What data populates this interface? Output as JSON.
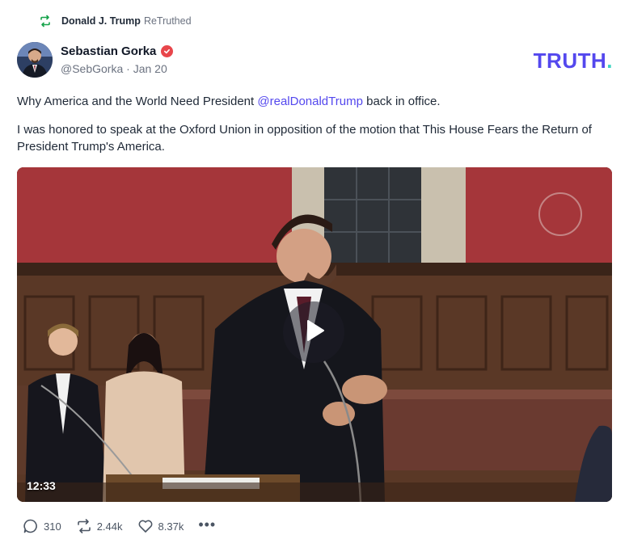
{
  "retruth": {
    "user": "Donald J. Trump",
    "action": "ReTruthed",
    "icon": "retruth-icon"
  },
  "post": {
    "author_name": "Sebastian Gorka",
    "verified_icon": "verified-badge-icon",
    "handle": "@SebGorka",
    "separator": "·",
    "date": "Jan 20",
    "text1_prefix": "Why America and the World Need President ",
    "text1_mention": "@realDonaldTrump",
    "text1_suffix": " back in office.",
    "text2": "I was honored to speak at the Oxford Union in opposition of the motion that This House Fears the Return of President Trump's America."
  },
  "brand": {
    "logo_text": "TRUTH",
    "logo_dot": ".",
    "primary_color": "#5448ee",
    "accent_color": "#3fd4c1"
  },
  "video": {
    "duration": "12:33",
    "play_icon": "play-icon"
  },
  "actions": {
    "replies": "310",
    "retruths": "2.44k",
    "likes": "8.37k",
    "more": "•••"
  }
}
